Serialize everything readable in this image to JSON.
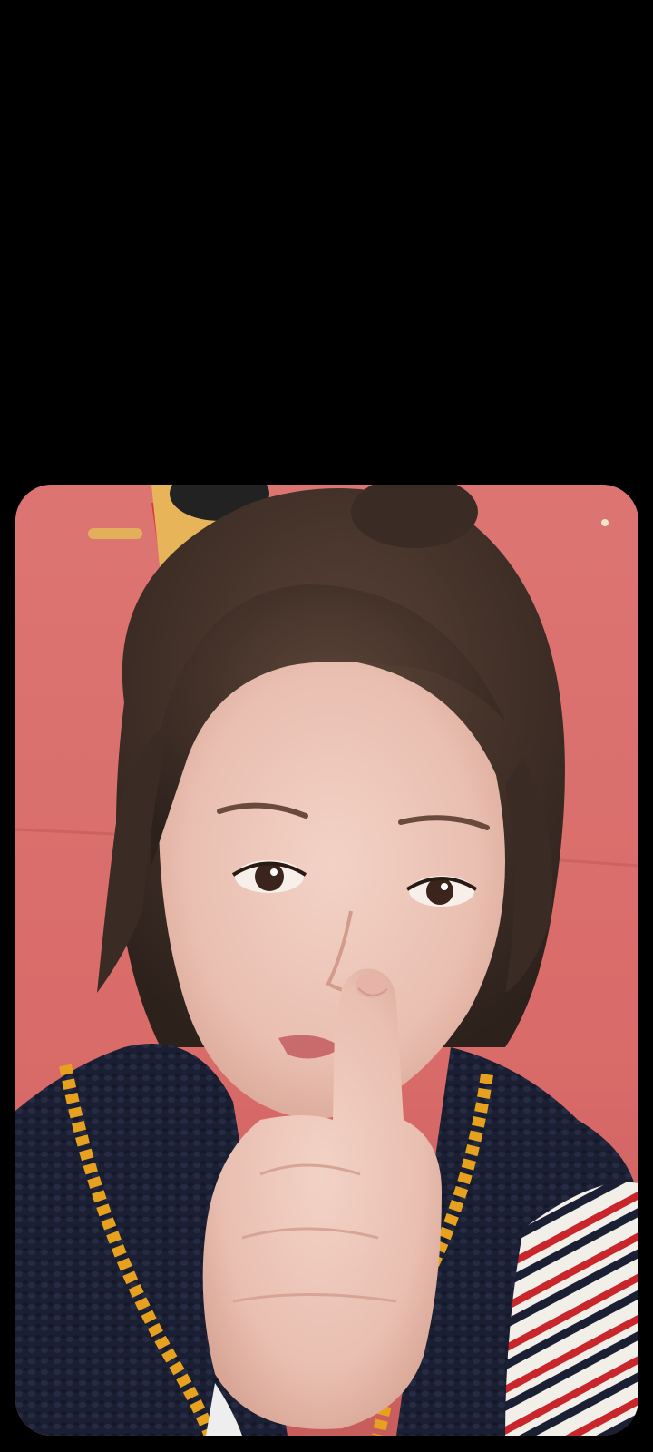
{
  "viewer": {
    "background_color": "#000000",
    "photo": {
      "subject": "selfie-photo",
      "backdrop_color": "#d86e6c"
    }
  },
  "icons": {
    "photo": "image-photo"
  }
}
